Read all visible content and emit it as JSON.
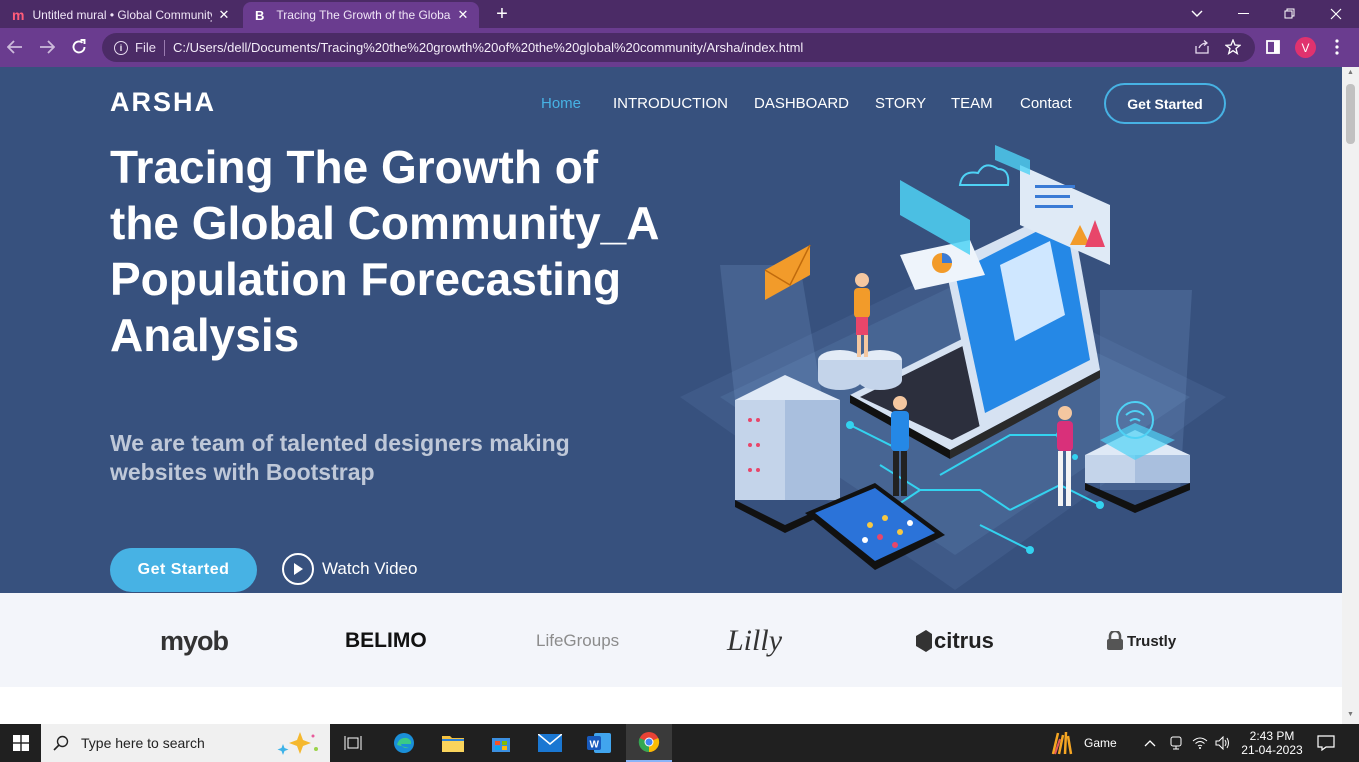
{
  "browser": {
    "tabs": [
      {
        "favicon": "m",
        "title": "Untitled mural • Global Community",
        "close": "✕"
      },
      {
        "favicon": "B",
        "title": "Tracing The Growth of the Global Community",
        "close": "✕"
      }
    ],
    "new_tab": "+",
    "address": {
      "scheme_label": "File",
      "url": "C:/Users/dell/Documents/Tracing%20the%20growth%20of%20the%20global%20community/Arsha/index.html"
    },
    "profile_initial": "V",
    "icons": [
      "back-icon",
      "forward-icon",
      "reload-icon",
      "info-icon",
      "share-icon",
      "star-icon",
      "sidebar-icon",
      "menu-icon"
    ]
  },
  "site": {
    "logo": "ARSHA",
    "nav": [
      {
        "label": "Home",
        "active": true
      },
      {
        "label": "INTRODUCTION"
      },
      {
        "label": "DASHBOARD"
      },
      {
        "label": "STORY"
      },
      {
        "label": "TEAM"
      },
      {
        "label": "Contact"
      }
    ],
    "nav_cta": "Get Started",
    "hero": {
      "title": "Tracing The Growth of the Global Community_A Population Forecasting Analysis",
      "subtitle": "We are team of talented designers making websites with Bootstrap",
      "cta": "Get Started",
      "watch": "Watch Video"
    },
    "clients": [
      "myob",
      "BELIMO",
      "LifeGroups",
      "Lilly",
      "citrus",
      "Trustly"
    ],
    "colors": {
      "hero_bg": "#37517e",
      "accent": "#47b2e4",
      "clients_bg": "#f3f5fa"
    }
  },
  "taskbar": {
    "search_placeholder": "Type here to search",
    "game_label": "Game",
    "time": "2:43 PM",
    "date": "21-04-2023"
  }
}
